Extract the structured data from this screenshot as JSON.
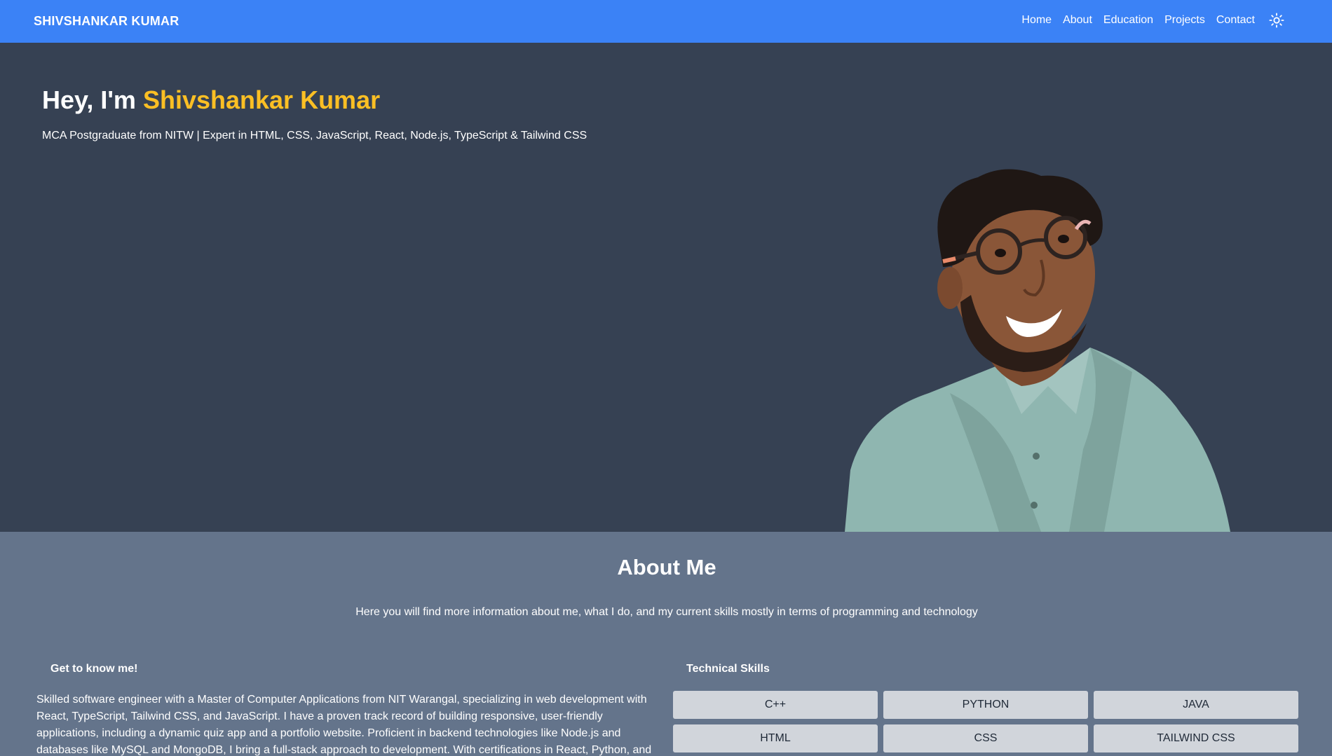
{
  "nav": {
    "brand": "SHIVSHANKAR KUMAR",
    "links": [
      "Home",
      "About",
      "Education",
      "Projects",
      "Contact"
    ],
    "theme_icon": "sun-icon"
  },
  "hero": {
    "greeting": "Hey, I'm",
    "name": "Shivshankar Kumar",
    "subtitle": "MCA Postgraduate from NITW | Expert in HTML, CSS, JavaScript, React, Node.js, TypeScript & Tailwind CSS"
  },
  "about": {
    "title": "About Me",
    "intro": "Here you will find more information about me, what I do, and my current skills mostly in terms of programming and technology",
    "left_heading": "Get to know me!",
    "body": "Skilled software engineer with a Master of Computer Applications from NIT Warangal, specializing in web development with React, TypeScript, Tailwind CSS, and JavaScript. I have a proven track record of building responsive, user-friendly applications, including a dynamic quiz app and a portfolio website. Proficient in backend technologies like Node.js and databases like MySQL and MongoDB, I bring a full-stack approach to development. With certifications in React, Python, and web",
    "right_heading": "Technical Skills",
    "skills": [
      "C++",
      "PYTHON",
      "JAVA",
      "HTML",
      "CSS",
      "TAILWIND CSS"
    ]
  },
  "colors": {
    "navbar": "#3b82f6",
    "hero_bg": "#364153",
    "about_bg": "#64748b",
    "accent": "#fbbf24",
    "skill_tile": "#d1d5db"
  }
}
